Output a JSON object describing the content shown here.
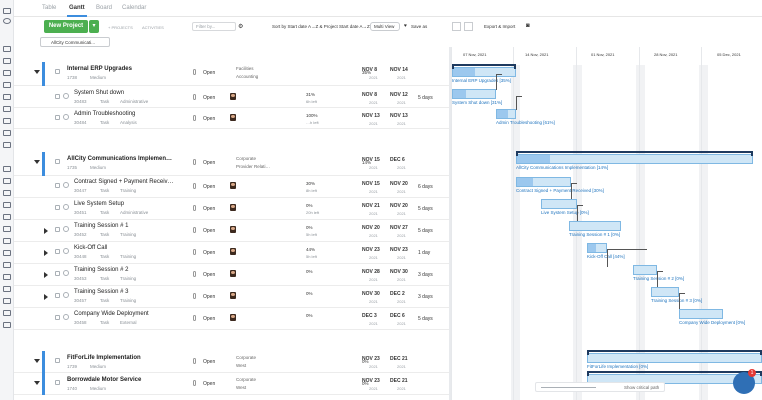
{
  "nav": {
    "tabs": [
      "Table",
      "Gantt",
      "Board",
      "Calendar"
    ],
    "active": "Gantt"
  },
  "toolbar": {
    "new_project": "New Project",
    "projects_lbl": "+ PROJECTS",
    "activities_lbl": "ACTIVITIES",
    "filter_placeholder": "Filter by...",
    "sort": "Sort by Start date A→Z & Project Start date A→Z",
    "multi_view": "Multi View",
    "save_as": "Save as",
    "export": "Export & Import"
  },
  "filter_chip": "AllCity Communicati...",
  "rows": [
    {
      "kind": "project",
      "title": "Internal ERP Upgrades",
      "id": "1738",
      "priority": "Medium",
      "status": "Open",
      "tag1": "Facilities",
      "tag2": "Accounting",
      "start": "NOV 8",
      "end": "NOV 14",
      "y1": "2021",
      "y2": "2021",
      "pct": "35%",
      "dur": ""
    },
    {
      "kind": "task",
      "title": "System Shut down",
      "id": "30483",
      "type": "Task",
      "cat": "Administrative",
      "status": "Open",
      "pct": "31%",
      "left": "6h left",
      "start": "NOV 8",
      "end": "NOV 12",
      "y1": "2021",
      "y2": "2021",
      "dur": "5 days"
    },
    {
      "kind": "task",
      "title": "Admin Troubleshooting",
      "id": "30484",
      "type": "Task",
      "cat": "Analysis",
      "status": "Open",
      "pct": "100%",
      "left": "…h left",
      "start": "NOV 13",
      "end": "NOV 13",
      "y1": "2021",
      "y2": "2021",
      "dur": ""
    },
    {
      "kind": "project",
      "title": "AllCity Communications Implemen…",
      "id": "1735",
      "priority": "Medium",
      "status": "Open",
      "tag1": "Corporate",
      "tag2": "Provider Relati…",
      "start": "NOV 15",
      "end": "DEC 6",
      "y1": "2021",
      "y2": "2021",
      "pct": "14%",
      "dur": ""
    },
    {
      "kind": "task",
      "title": "Contract Signed + Payment Receiv…",
      "id": "30447",
      "type": "Task",
      "cat": "Training",
      "status": "Open",
      "pct": "30%",
      "left": "8h left",
      "start": "NOV 15",
      "end": "NOV 20",
      "y1": "2021",
      "y2": "2021",
      "dur": "6 days"
    },
    {
      "kind": "task",
      "title": "Live System Setup",
      "id": "30451",
      "type": "Task",
      "cat": "Administrative",
      "status": "Open",
      "pct": "0%",
      "left": "20h left",
      "start": "NOV 21",
      "end": "NOV 20",
      "y1": "2021",
      "y2": "2021",
      "dur": "5 days"
    },
    {
      "kind": "task",
      "title": "Training Session # 1",
      "id": "30452",
      "type": "Task",
      "cat": "Training",
      "status": "Open",
      "pct": "0%",
      "left": "5h left",
      "start": "NOV 20",
      "end": "NOV 27",
      "y1": "2021",
      "y2": "2021",
      "dur": "5 days"
    },
    {
      "kind": "task",
      "title": "Kick-Off Call",
      "id": "30448",
      "type": "Task",
      "cat": "Training",
      "status": "Open",
      "pct": "44%",
      "left": "5h left",
      "start": "NOV 23",
      "end": "NOV 23",
      "y1": "2021",
      "y2": "2021",
      "dur": "1 day"
    },
    {
      "kind": "task",
      "title": "Training Session # 2",
      "id": "30453",
      "type": "Task",
      "cat": "Training",
      "status": "Open",
      "pct": "0%",
      "left": "",
      "start": "NOV 28",
      "end": "NOV 30",
      "y1": "2021",
      "y2": "2021",
      "dur": "3 days"
    },
    {
      "kind": "task",
      "title": "Training Session # 3",
      "id": "30457",
      "type": "Task",
      "cat": "Training",
      "status": "Open",
      "pct": "0%",
      "left": "",
      "start": "NOV 30",
      "end": "DEC 2",
      "y1": "2021",
      "y2": "2021",
      "dur": "3 days"
    },
    {
      "kind": "task",
      "title": "Company Wide Deployment",
      "id": "30458",
      "type": "Task",
      "cat": "External",
      "status": "Open",
      "pct": "0%",
      "left": "",
      "start": "DEC 3",
      "end": "DEC 6",
      "y1": "2021",
      "y2": "2021",
      "dur": "5 days"
    },
    {
      "kind": "project",
      "title": "FitForLife Implementation",
      "id": "1739",
      "priority": "Medium",
      "status": "Open",
      "tag1": "Corporate",
      "tag2": "West",
      "start": "NOV 23",
      "end": "DEC 21",
      "y1": "2021",
      "y2": "2021",
      "pct": "0%",
      "dur": ""
    },
    {
      "kind": "project",
      "title": "Borrowdale Motor Service",
      "id": "1740",
      "priority": "Medium",
      "status": "Open",
      "tag1": "Corporate",
      "tag2": "West",
      "start": "NOV 23",
      "end": "DEC 21",
      "y1": "2021",
      "y2": "2021",
      "pct": "0%",
      "dur": ""
    }
  ],
  "gantt": {
    "months": [
      "07 Nov, 2021",
      "14 Nov, 2021",
      "01 Nov, 2021",
      "28 Nov, 2021",
      "05 Dec, 2021"
    ],
    "labels": [
      "Internal ERP Upgrades [35%]",
      "System Shut down [31%]",
      "Admin Troubleshooting [61%]",
      "AllCity Communications Implementation [14%]",
      "Contract Signed + Payment Received [30%]",
      "Live System Setup [0%]",
      "Training Session # 1 [0%]",
      "Kick-Off Call [44%]",
      "Training Session # 2 [0%]",
      "Training Session # 3 [0%]",
      "Company Wide Deployment [0%]",
      "FitForLife Implementation [0%]",
      "… Service [0%]"
    ],
    "show_critical": "Show critical path"
  },
  "chat_badge": "1"
}
